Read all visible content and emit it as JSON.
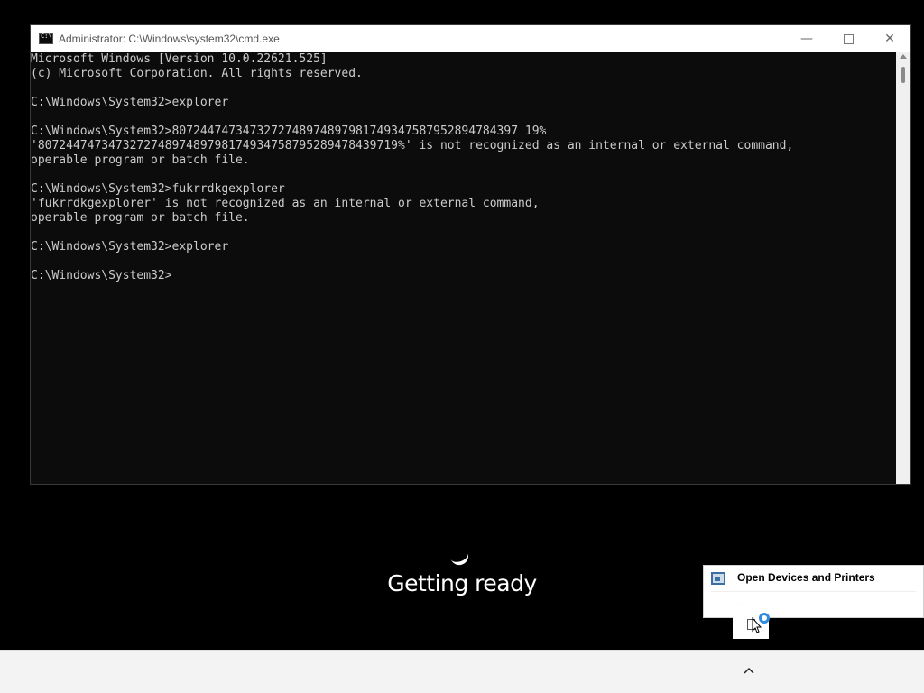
{
  "window": {
    "title": "Administrator: C:\\Windows\\system32\\cmd.exe",
    "minimize_symbol": "—",
    "close_symbol": "✕"
  },
  "console": {
    "text": "Microsoft Windows [Version 10.0.22621.525]\n(c) Microsoft Corporation. All rights reserved.\n\nC:\\Windows\\System32>explorer\n\nC:\\Windows\\System32>8072447473473272748974897981749347587952894784397 19%\n'807244747347327274897489798174934758795289478439719%' is not recognized as an internal or external command,\noperable program or batch file.\n\nC:\\Windows\\System32>fukrrdkgexplorer\n'fukrrdkgexplorer' is not recognized as an internal or external command,\noperable program or batch file.\n\nC:\\Windows\\System32>explorer\n\nC:\\Windows\\System32>"
  },
  "overlay": {
    "status_text": "Getting ready"
  },
  "popup": {
    "title": "Open Devices and Printers",
    "ellipsis": "..."
  },
  "taskbar": {
    "chevron": "^"
  },
  "icons": {
    "cmd": "cmd-icon",
    "devices": "devices-printers-icon",
    "cursor": "mouse-cursor-icon",
    "busy": "busy-spinner-icon"
  }
}
